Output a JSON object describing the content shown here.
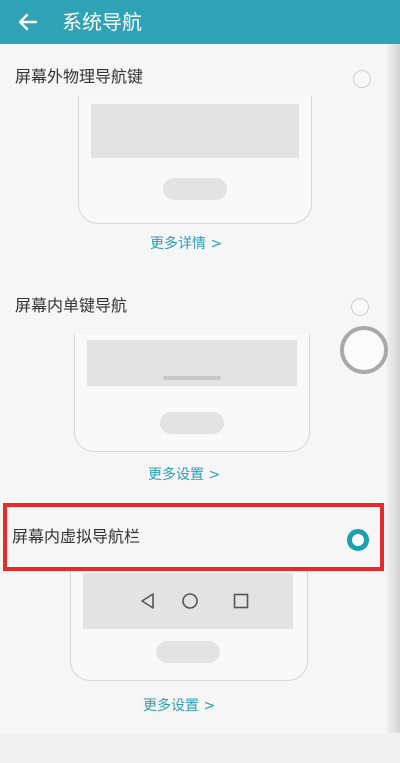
{
  "header": {
    "title": "系统导航",
    "back_icon": "arrow-left-icon"
  },
  "options": [
    {
      "label": "屏幕外物理导航键",
      "selected": false,
      "link": "更多详情 >"
    },
    {
      "label": "屏幕内单键导航",
      "selected": false,
      "link": "更多设置 >"
    },
    {
      "label": "屏幕内虚拟导航栏",
      "selected": true,
      "link": "更多设置 >"
    }
  ],
  "colors": {
    "header": "#2fa3b5",
    "accent": "#1b9fb3",
    "highlight": "#e82a2a"
  }
}
